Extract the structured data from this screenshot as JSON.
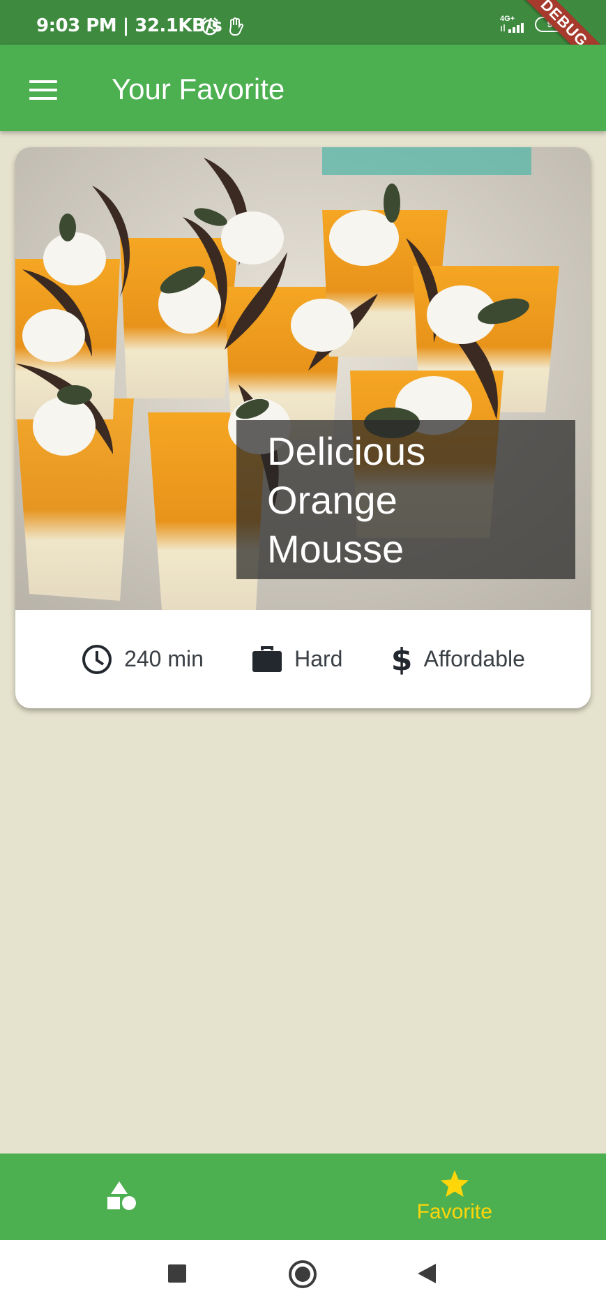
{
  "status_bar": {
    "time": "9:03 PM | 32.1KB/s",
    "network": "4G+",
    "battery": "99",
    "debug_banner": "DEBUG",
    "icons": [
      "alarm-icon",
      "hand-icon",
      "signal-icon",
      "battery-icon"
    ]
  },
  "app_bar": {
    "title": "Your Favorite",
    "menu_icon": "menu-icon"
  },
  "meal_card": {
    "title_lines": [
      "Delicious",
      "Orange",
      "Mousse"
    ],
    "image": "orange-mousse-photo",
    "duration": "240 min",
    "complexity": "Hard",
    "affordability": "Affordable",
    "icons": [
      "clock-icon",
      "briefcase-icon",
      "dollar-icon"
    ]
  },
  "bottom_nav": {
    "tabs": [
      {
        "label": "",
        "icon": "category-icon",
        "active": false
      },
      {
        "label": "Favorite",
        "icon": "star-icon",
        "active": true
      }
    ],
    "active_color": "#ffd60a",
    "background": "#4caf50"
  },
  "system_nav": {
    "buttons": [
      "recents-icon",
      "home-icon",
      "back-icon"
    ]
  },
  "colors": {
    "primary": "#4caf50",
    "status_bar": "#3e8a3f",
    "background": "#e5e2cd",
    "accent": "#ffd60a"
  }
}
